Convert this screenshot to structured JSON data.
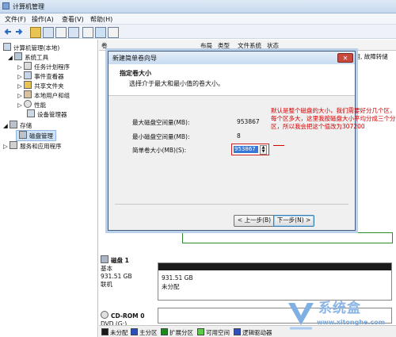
{
  "window": {
    "title": "计算机管理"
  },
  "menu": [
    "文件(F)",
    "操作(A)",
    "查看(V)",
    "帮助(H)"
  ],
  "tree": {
    "root": "计算机管理(本地)",
    "system_tools": "系统工具",
    "task_scheduler": "任务计划程序",
    "event_viewer": "事件查看器",
    "shared_folders": "共享文件夹",
    "local_users": "本地用户和组",
    "performance": "性能",
    "device_manager": "设备管理器",
    "storage": "存储",
    "disk_management": "磁盘管理",
    "services": "服务和应用程序"
  },
  "columns": [
    "卷",
    "布局",
    "类型",
    "文件系统",
    "状态"
  ],
  "right_text": "可用, 故障转储",
  "wizard": {
    "title": "新建简单卷向导",
    "close": "✕",
    "heading": "指定卷大小",
    "subheading": "选择介于最大和最小值的卷大小。",
    "max_label": "最大磁盘空间量(MB):",
    "max_value": "953867",
    "min_label": "最小磁盘空间量(MB):",
    "min_value": "8",
    "size_label": "简单卷大小(MB)(S):",
    "size_value": "953867",
    "back": "< 上一步(B)",
    "next": "下一步(N) >"
  },
  "annotation": "默认是整个磁盘的大小，我们需要好分几个区，每个区多大，这里我按磁盘大小平均分成三个分区，所以我会把这个值改为307200",
  "disk1": {
    "name": "磁盘 1",
    "type": "基本",
    "size": "931.51 GB",
    "status": "联机",
    "part_size": "931.51 GB",
    "part_state": "未分配"
  },
  "cdrom": {
    "name": "CD-ROM 0",
    "type": "DVD (G:)"
  },
  "legend": [
    "未分配",
    "主分区",
    "扩展分区",
    "可用空间",
    "逻辑驱动器"
  ],
  "legend_colors": [
    "#1a1a1a",
    "#2a4fb8",
    "#1e8a1e",
    "#5ecb4a",
    "#3050c0"
  ],
  "watermark": {
    "text": "系统盒",
    "url": "www.xitonghe.com"
  }
}
